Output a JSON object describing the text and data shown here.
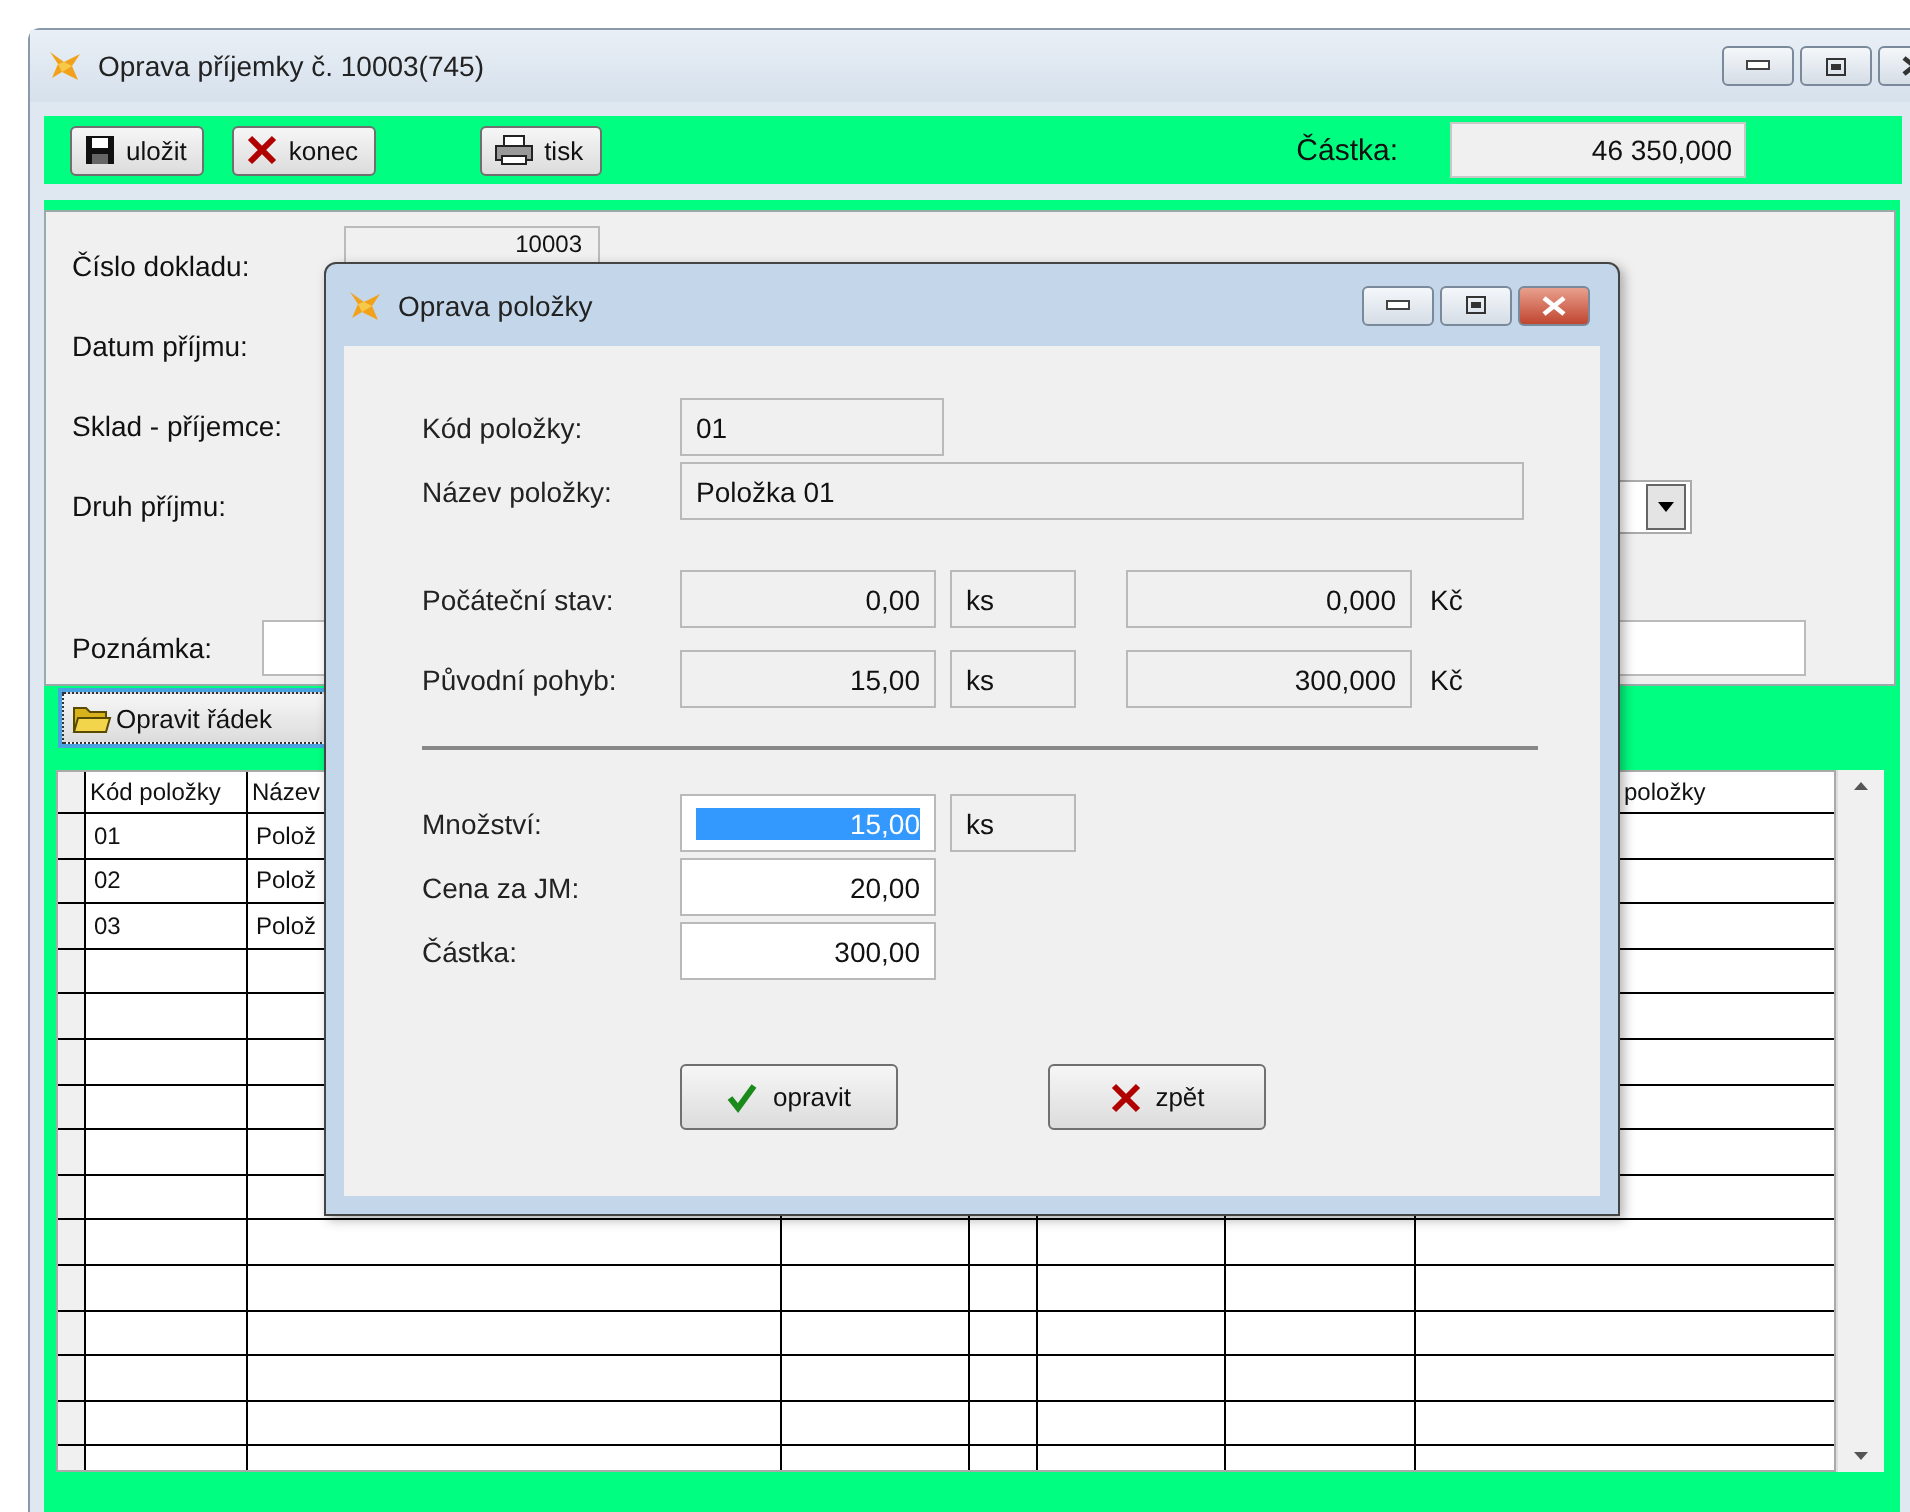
{
  "window": {
    "title": "Oprava příjemky č. 10003(745)"
  },
  "toolbar": {
    "buttons": [
      {
        "label": "uložit",
        "kind": "save"
      },
      {
        "label": "konec",
        "kind": "close"
      },
      {
        "label": "tisk",
        "kind": "print"
      }
    ],
    "amount_label": "Částka:",
    "amount": "46 350,000"
  },
  "form": {
    "fields": [
      {
        "label": "Číslo dokladu:",
        "kind": "number",
        "value": "10003"
      },
      {
        "label": "Datum příjmu:",
        "kind": "hidden"
      },
      {
        "label": "Sklad - příjemce:",
        "kind": "hidden"
      },
      {
        "label": "Druh příjmu:",
        "kind": "combo"
      },
      {
        "label": "Poznámka:",
        "kind": "text"
      }
    ]
  },
  "edit_row_button": "Opravit řádek",
  "grid": {
    "columns": [
      "Kód položky",
      "Název",
      "položky"
    ],
    "rows": [
      [
        "01",
        "Polož"
      ],
      [
        "02",
        "Polož"
      ],
      [
        "03",
        "Polož"
      ]
    ]
  },
  "dialog": {
    "title": "Oprava položky",
    "item_code": {
      "label": "Kód položky:",
      "value": "01"
    },
    "item_name": {
      "label": "Název položky:",
      "value": "Položka 01"
    },
    "stock_rows": [
      {
        "label": "Počáteční stav:",
        "quantity": "0,00",
        "unit": "ks",
        "amount": "0,000",
        "currency": "Kč"
      },
      {
        "label": "Původní pohyb:",
        "quantity": "15,00",
        "unit": "ks",
        "amount": "300,000",
        "currency": "Kč"
      }
    ],
    "inputs": [
      {
        "label": "Množství:",
        "value": "15,00",
        "selected": true,
        "unit": "ks"
      },
      {
        "label": "Cena za JM:",
        "value": "20,00",
        "selected": false
      },
      {
        "label": "Částka:",
        "value": "300,00",
        "selected": false
      }
    ],
    "buttons": [
      {
        "label": "opravit",
        "kind": "confirm"
      },
      {
        "label": "zpět",
        "kind": "cancel"
      }
    ]
  }
}
